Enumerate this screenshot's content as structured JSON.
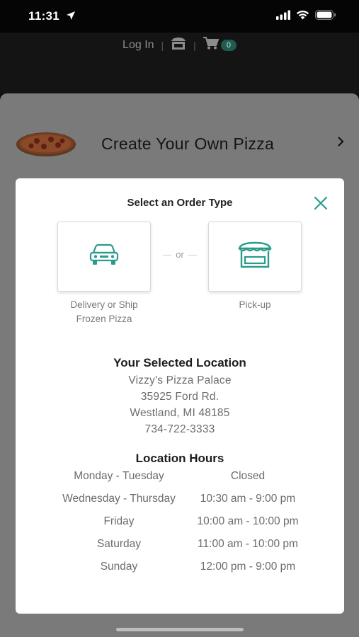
{
  "status_bar": {
    "time": "11:31"
  },
  "header": {
    "login_label": "Log In",
    "separator": "|",
    "cart_count": "0"
  },
  "menu": {
    "item_title": "Create Your Own Pizza"
  },
  "modal": {
    "title": "Select an Order Type",
    "or_label": "or",
    "options": [
      {
        "label_line1": "Delivery or Ship",
        "label_line2": "Frozen Pizza",
        "icon": "car-icon"
      },
      {
        "label_line1": "Pick-up",
        "icon": "storefront-icon"
      }
    ],
    "location": {
      "heading": "Your Selected Location",
      "name": "Vizzy's Pizza Palace",
      "street": "35925 Ford Rd.",
      "city": "Westland, MI 48185",
      "phone": "734-722-3333"
    },
    "hours": {
      "heading": "Location Hours",
      "rows": [
        {
          "day": "Monday - Tuesday",
          "time": "Closed"
        },
        {
          "day": "Wednesday - Thursday",
          "time": "10:30 am - 9:00 pm"
        },
        {
          "day": "Friday",
          "time": "10:00 am - 10:00 pm"
        },
        {
          "day": "Saturday",
          "time": "11:00 am - 10:00 pm"
        },
        {
          "day": "Sunday",
          "time": "12:00 pm - 9:00 pm"
        }
      ]
    }
  },
  "colors": {
    "accent_teal": "#2b9b8c",
    "overlay_dim": "#7a7a7a",
    "badge_green": "#1f5b50"
  }
}
